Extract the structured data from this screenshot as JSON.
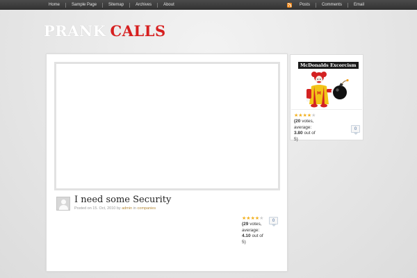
{
  "topnav": {
    "left_items": [
      "Home",
      "Sample Page",
      "Sitemap",
      "Archives",
      "About"
    ],
    "right_items": [
      "Posts",
      "Comments",
      "Email"
    ]
  },
  "logo": {
    "part1": "PRANK",
    "part2": "CALLS"
  },
  "post": {
    "title": "I need some Security",
    "meta_prefix": "Posted on 15. Oct, 2010 by",
    "author": "admin",
    "meta_in": "in",
    "category": "companies",
    "rating": {
      "stars": 4,
      "votes_count": "(29",
      "votes_label": "votes, average:",
      "average": "4.10",
      "out_of": "out of 5)"
    },
    "comments_count": "0"
  },
  "sidebar_post": {
    "caption": "McDonalds Excorcism",
    "rating": {
      "stars": 4,
      "votes_count": "(20",
      "votes_label": "votes, average:",
      "average": "3.80",
      "out_of": "out of 5)"
    },
    "comments_count": "0"
  },
  "colors": {
    "accent_red": "#d61f1f",
    "topbar": "#3d3d3d",
    "link_gold": "#b58a3a",
    "star_gold": "#f2b01e",
    "rss_orange": "#f08a1e"
  },
  "icons": [
    "rss-icon",
    "avatar-placeholder-icon",
    "star-icon",
    "comment-bubble-icon"
  ]
}
